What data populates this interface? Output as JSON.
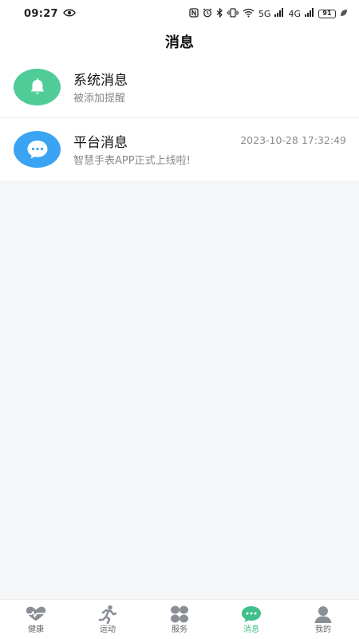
{
  "status_bar": {
    "time": "09:27",
    "network_left": "5G",
    "network_right": "4G",
    "battery": "91"
  },
  "header": {
    "title": "消息"
  },
  "messages": [
    {
      "title": "系统消息",
      "subtitle": "被添加提醒",
      "time": "",
      "icon": "bell-icon",
      "color": "#4fcc97"
    },
    {
      "title": "平台消息",
      "subtitle": "智慧手表APP正式上线啦!",
      "time": "2023-10-28 17:32:49",
      "icon": "chat-icon",
      "color": "#3aa3f2"
    }
  ],
  "tabbar": {
    "active_color": "#3fbf8a",
    "items": [
      {
        "label": "健康",
        "icon": "heart-pulse-icon"
      },
      {
        "label": "运动",
        "icon": "runner-icon"
      },
      {
        "label": "服务",
        "icon": "grid-icon"
      },
      {
        "label": "消息",
        "icon": "message-icon"
      },
      {
        "label": "我的",
        "icon": "person-icon"
      }
    ]
  }
}
